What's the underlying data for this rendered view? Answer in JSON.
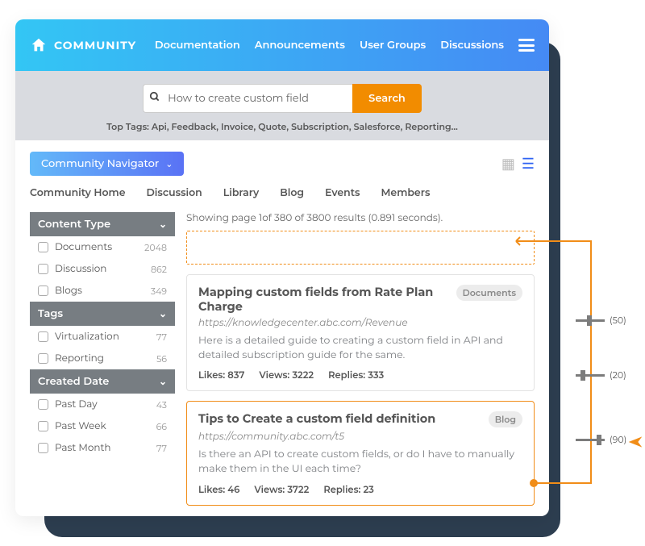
{
  "brand": "COMMUNITY",
  "nav": {
    "doc": "Documentation",
    "ann": "Announcements",
    "ug": "User Groups",
    "disc": "Discussions"
  },
  "search": {
    "value": "How to create custom field",
    "button": "Search"
  },
  "toptags": "Top Tags: Api, Feedback, Invoice, Quote, Subscription, Salesforce, Reporting…",
  "navigator": "Community Navigator",
  "tabs": {
    "home": "Community Home",
    "disc": "Discussion",
    "lib": "Library",
    "blog": "Blog",
    "evt": "Events",
    "mem": "Members"
  },
  "facets": {
    "ct": {
      "title": "Content Type",
      "items": [
        {
          "label": "Documents",
          "count": "2048"
        },
        {
          "label": "Discussion",
          "count": "862"
        },
        {
          "label": "Blogs",
          "count": "349"
        }
      ]
    },
    "tg": {
      "title": "Tags",
      "items": [
        {
          "label": "Virtualization",
          "count": "77"
        },
        {
          "label": "Reporting",
          "count": "56"
        }
      ]
    },
    "cd": {
      "title": "Created Date",
      "items": [
        {
          "label": "Past Day",
          "count": "43"
        },
        {
          "label": "Past Week",
          "count": "66"
        },
        {
          "label": "Past Month",
          "count": "77"
        }
      ]
    }
  },
  "results": {
    "summary": "Showing page 1of 380 of 3800 results (0.891 seconds).",
    "r1": {
      "title": "Mapping custom fields from Rate Plan Charge",
      "badge": "Documents",
      "url": "https://knowledgecenter.abc.com/Revenue",
      "desc": "Here is a detailed guide to creating a custom field in API and detailed subscription guide for the same.",
      "likes": "Likes: 837",
      "views": "Views: 3222",
      "replies": "Replies: 333"
    },
    "r2": {
      "title": "Tips to Create a custom field definition",
      "badge": "Blog",
      "url": "https://community.abc.com/t5",
      "desc": "Is there an API to create custom fields, or do I have to manually make them in the UI each time?",
      "likes": "Likes: 46",
      "views": "Views: 3722",
      "replies": "Replies: 23"
    }
  },
  "annotations": {
    "a1": "(50)",
    "a2": "(20)",
    "a3": "(90)"
  },
  "colors": {
    "accent": "#f18d18",
    "grad1": "#33c6f4",
    "grad2": "#458af4"
  }
}
